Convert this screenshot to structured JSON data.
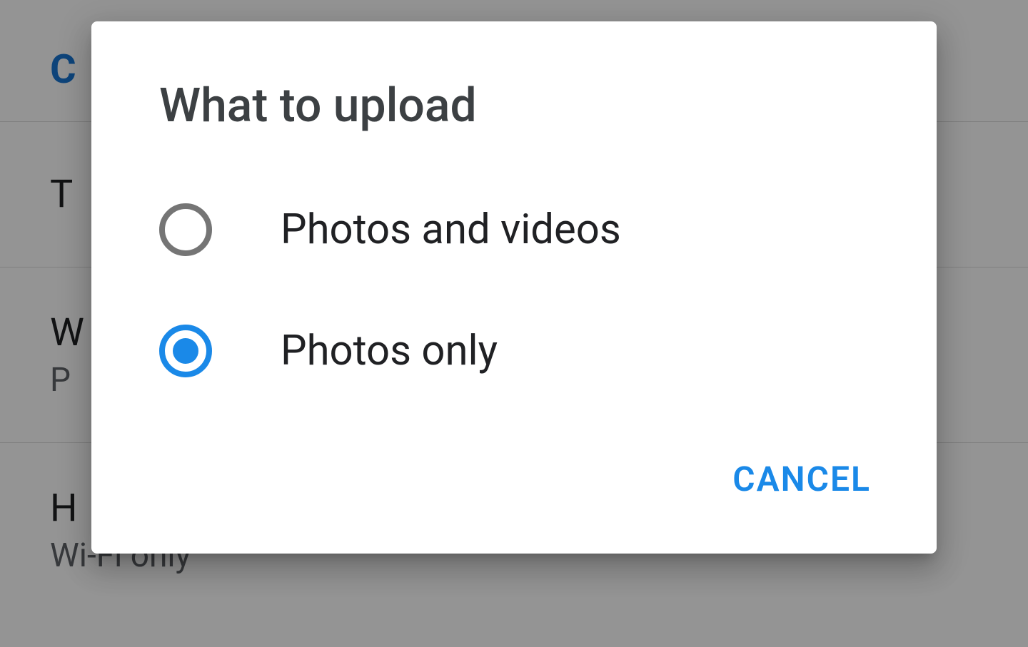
{
  "background": {
    "item_c": "C",
    "item_t": "T",
    "item_w_primary": "W",
    "item_w_secondary": "P",
    "item_h_primary": "H",
    "item_h_secondary": "Wi-Fi only"
  },
  "dialog": {
    "title": "What to upload",
    "options": [
      {
        "label": "Photos and videos",
        "selected": false
      },
      {
        "label": "Photos only",
        "selected": true
      }
    ],
    "cancel_label": "CANCEL"
  }
}
